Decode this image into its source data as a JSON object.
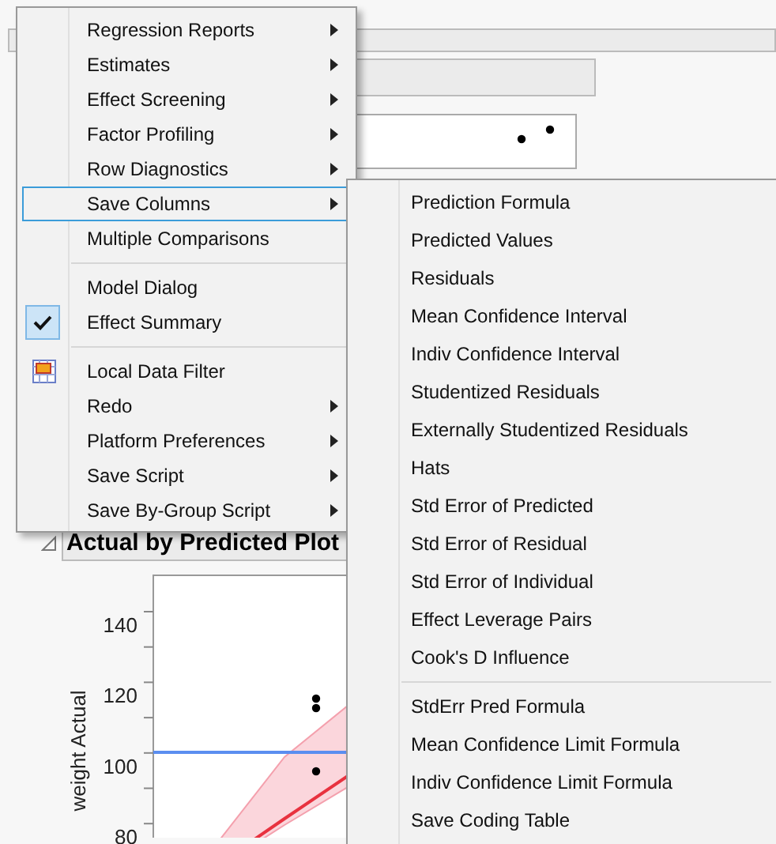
{
  "report": {
    "section_title": "Actual by Predicted Plot",
    "plot": {
      "ylabel": "weight Actual",
      "yticks": [
        "140",
        "120",
        "100",
        "80"
      ]
    }
  },
  "menu": {
    "items": [
      {
        "kind": "submenu",
        "label": "Regression Reports",
        "selected": false
      },
      {
        "kind": "submenu",
        "label": "Estimates",
        "selected": false
      },
      {
        "kind": "submenu",
        "label": "Effect Screening",
        "selected": false
      },
      {
        "kind": "submenu",
        "label": "Factor Profiling",
        "selected": false
      },
      {
        "kind": "submenu",
        "label": "Row Diagnostics",
        "selected": false
      },
      {
        "kind": "submenu",
        "label": "Save Columns",
        "selected": true
      },
      {
        "kind": "item",
        "label": "Multiple Comparisons",
        "selected": false
      },
      {
        "kind": "separator"
      },
      {
        "kind": "item",
        "label": "Model Dialog",
        "selected": false
      },
      {
        "kind": "check",
        "label": "Effect Summary",
        "checked": true,
        "selected": false
      },
      {
        "kind": "separator"
      },
      {
        "kind": "icon",
        "label": "Local Data Filter",
        "selected": false
      },
      {
        "kind": "submenu",
        "label": "Redo",
        "selected": false
      },
      {
        "kind": "submenu",
        "label": "Platform Preferences",
        "selected": false
      },
      {
        "kind": "submenu",
        "label": "Save Script",
        "selected": false
      },
      {
        "kind": "submenu",
        "label": "Save By-Group Script",
        "selected": false
      }
    ]
  },
  "submenu": {
    "items": [
      {
        "kind": "item",
        "label": "Prediction Formula"
      },
      {
        "kind": "item",
        "label": "Predicted Values"
      },
      {
        "kind": "item",
        "label": "Residuals"
      },
      {
        "kind": "item",
        "label": "Mean Confidence Interval"
      },
      {
        "kind": "item",
        "label": "Indiv Confidence Interval"
      },
      {
        "kind": "item",
        "label": "Studentized Residuals"
      },
      {
        "kind": "item",
        "label": "Externally Studentized Residuals"
      },
      {
        "kind": "item",
        "label": "Hats"
      },
      {
        "kind": "item",
        "label": "Std Error of Predicted"
      },
      {
        "kind": "item",
        "label": "Std Error of Residual"
      },
      {
        "kind": "item",
        "label": "Std Error of Individual"
      },
      {
        "kind": "item",
        "label": "Effect Leverage Pairs"
      },
      {
        "kind": "item",
        "label": "Cook's D Influence"
      },
      {
        "kind": "separator"
      },
      {
        "kind": "item",
        "label": "StdErr Pred Formula"
      },
      {
        "kind": "item",
        "label": "Mean Confidence Limit Formula"
      },
      {
        "kind": "item",
        "label": "Indiv Confidence Limit Formula"
      },
      {
        "kind": "item",
        "label": "Save Coding Table"
      }
    ]
  }
}
